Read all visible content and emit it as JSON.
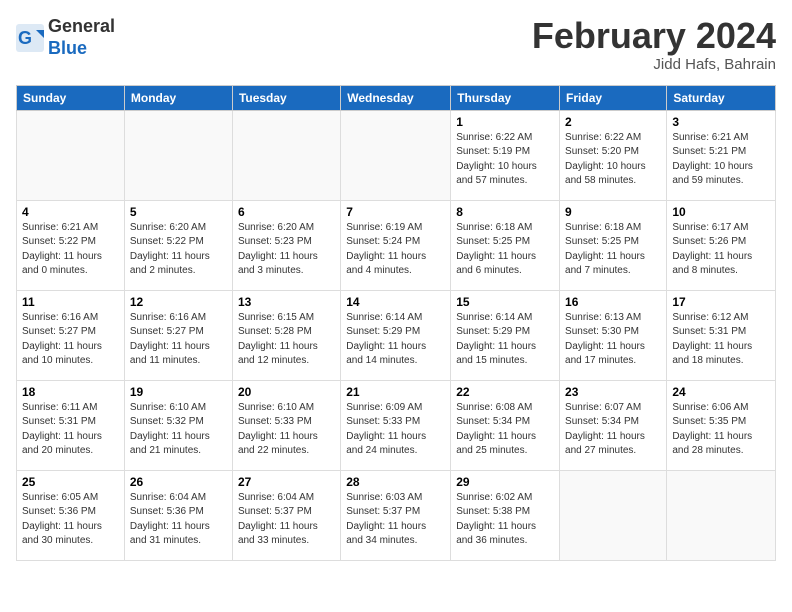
{
  "header": {
    "logo_line1": "General",
    "logo_line2": "Blue",
    "month_title": "February 2024",
    "location": "Jidd Hafs, Bahrain"
  },
  "days_of_week": [
    "Sunday",
    "Monday",
    "Tuesday",
    "Wednesday",
    "Thursday",
    "Friday",
    "Saturday"
  ],
  "weeks": [
    [
      {
        "day": "",
        "info": ""
      },
      {
        "day": "",
        "info": ""
      },
      {
        "day": "",
        "info": ""
      },
      {
        "day": "",
        "info": ""
      },
      {
        "day": "1",
        "info": "Sunrise: 6:22 AM\nSunset: 5:19 PM\nDaylight: 10 hours\nand 57 minutes."
      },
      {
        "day": "2",
        "info": "Sunrise: 6:22 AM\nSunset: 5:20 PM\nDaylight: 10 hours\nand 58 minutes."
      },
      {
        "day": "3",
        "info": "Sunrise: 6:21 AM\nSunset: 5:21 PM\nDaylight: 10 hours\nand 59 minutes."
      }
    ],
    [
      {
        "day": "4",
        "info": "Sunrise: 6:21 AM\nSunset: 5:22 PM\nDaylight: 11 hours\nand 0 minutes."
      },
      {
        "day": "5",
        "info": "Sunrise: 6:20 AM\nSunset: 5:22 PM\nDaylight: 11 hours\nand 2 minutes."
      },
      {
        "day": "6",
        "info": "Sunrise: 6:20 AM\nSunset: 5:23 PM\nDaylight: 11 hours\nand 3 minutes."
      },
      {
        "day": "7",
        "info": "Sunrise: 6:19 AM\nSunset: 5:24 PM\nDaylight: 11 hours\nand 4 minutes."
      },
      {
        "day": "8",
        "info": "Sunrise: 6:18 AM\nSunset: 5:25 PM\nDaylight: 11 hours\nand 6 minutes."
      },
      {
        "day": "9",
        "info": "Sunrise: 6:18 AM\nSunset: 5:25 PM\nDaylight: 11 hours\nand 7 minutes."
      },
      {
        "day": "10",
        "info": "Sunrise: 6:17 AM\nSunset: 5:26 PM\nDaylight: 11 hours\nand 8 minutes."
      }
    ],
    [
      {
        "day": "11",
        "info": "Sunrise: 6:16 AM\nSunset: 5:27 PM\nDaylight: 11 hours\nand 10 minutes."
      },
      {
        "day": "12",
        "info": "Sunrise: 6:16 AM\nSunset: 5:27 PM\nDaylight: 11 hours\nand 11 minutes."
      },
      {
        "day": "13",
        "info": "Sunrise: 6:15 AM\nSunset: 5:28 PM\nDaylight: 11 hours\nand 12 minutes."
      },
      {
        "day": "14",
        "info": "Sunrise: 6:14 AM\nSunset: 5:29 PM\nDaylight: 11 hours\nand 14 minutes."
      },
      {
        "day": "15",
        "info": "Sunrise: 6:14 AM\nSunset: 5:29 PM\nDaylight: 11 hours\nand 15 minutes."
      },
      {
        "day": "16",
        "info": "Sunrise: 6:13 AM\nSunset: 5:30 PM\nDaylight: 11 hours\nand 17 minutes."
      },
      {
        "day": "17",
        "info": "Sunrise: 6:12 AM\nSunset: 5:31 PM\nDaylight: 11 hours\nand 18 minutes."
      }
    ],
    [
      {
        "day": "18",
        "info": "Sunrise: 6:11 AM\nSunset: 5:31 PM\nDaylight: 11 hours\nand 20 minutes."
      },
      {
        "day": "19",
        "info": "Sunrise: 6:10 AM\nSunset: 5:32 PM\nDaylight: 11 hours\nand 21 minutes."
      },
      {
        "day": "20",
        "info": "Sunrise: 6:10 AM\nSunset: 5:33 PM\nDaylight: 11 hours\nand 22 minutes."
      },
      {
        "day": "21",
        "info": "Sunrise: 6:09 AM\nSunset: 5:33 PM\nDaylight: 11 hours\nand 24 minutes."
      },
      {
        "day": "22",
        "info": "Sunrise: 6:08 AM\nSunset: 5:34 PM\nDaylight: 11 hours\nand 25 minutes."
      },
      {
        "day": "23",
        "info": "Sunrise: 6:07 AM\nSunset: 5:34 PM\nDaylight: 11 hours\nand 27 minutes."
      },
      {
        "day": "24",
        "info": "Sunrise: 6:06 AM\nSunset: 5:35 PM\nDaylight: 11 hours\nand 28 minutes."
      }
    ],
    [
      {
        "day": "25",
        "info": "Sunrise: 6:05 AM\nSunset: 5:36 PM\nDaylight: 11 hours\nand 30 minutes."
      },
      {
        "day": "26",
        "info": "Sunrise: 6:04 AM\nSunset: 5:36 PM\nDaylight: 11 hours\nand 31 minutes."
      },
      {
        "day": "27",
        "info": "Sunrise: 6:04 AM\nSunset: 5:37 PM\nDaylight: 11 hours\nand 33 minutes."
      },
      {
        "day": "28",
        "info": "Sunrise: 6:03 AM\nSunset: 5:37 PM\nDaylight: 11 hours\nand 34 minutes."
      },
      {
        "day": "29",
        "info": "Sunrise: 6:02 AM\nSunset: 5:38 PM\nDaylight: 11 hours\nand 36 minutes."
      },
      {
        "day": "",
        "info": ""
      },
      {
        "day": "",
        "info": ""
      }
    ]
  ]
}
